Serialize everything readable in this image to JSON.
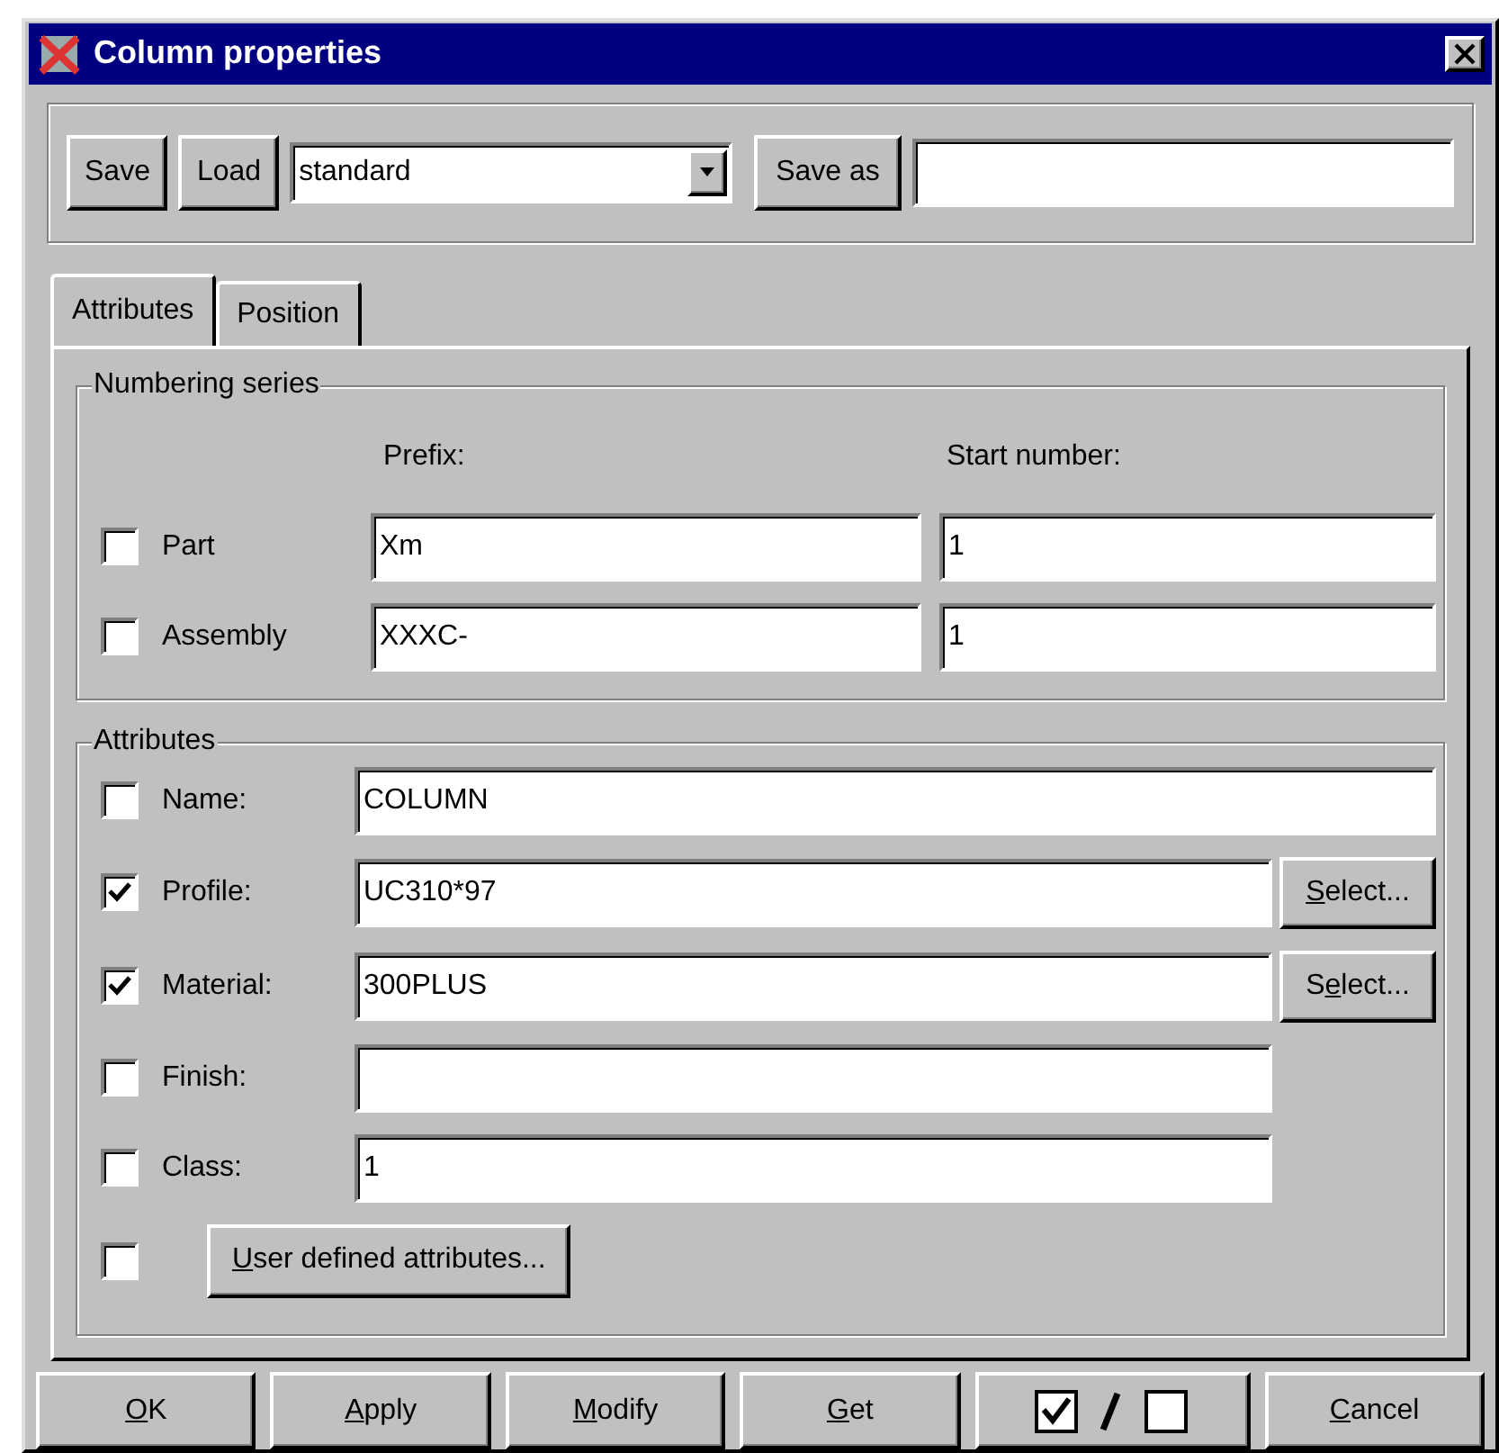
{
  "window": {
    "title": "Column properties"
  },
  "toolbar": {
    "save": "Save",
    "load": "Load",
    "preset": "standard",
    "save_as": "Save as"
  },
  "tabs": [
    {
      "label": "Attributes",
      "selected": true
    },
    {
      "label": "Position",
      "selected": false
    }
  ],
  "numbering": {
    "title": "Numbering series",
    "headers": [
      "Prefix:",
      "Start number:"
    ],
    "rows": [
      {
        "label": "Part",
        "checked": false,
        "prefix": "Xm",
        "start": "1"
      },
      {
        "label": "Assembly",
        "checked": false,
        "prefix": "XXXC-",
        "start": "1"
      }
    ]
  },
  "attributes": {
    "title": "Attributes",
    "rows": [
      {
        "kind": "wide",
        "label": "Name:",
        "checked": false,
        "value": "COLUMN"
      },
      {
        "kind": "select",
        "label": "Profile:",
        "checked": true,
        "value": "UC310*97",
        "button": {
          "key": "S",
          "after": "elect..."
        }
      },
      {
        "kind": "select",
        "label": "Material:",
        "checked": true,
        "value": "300PLUS",
        "button": {
          "before": "S",
          "key": "e",
          "after": "lect..."
        }
      },
      {
        "kind": "field",
        "label": "Finish:",
        "checked": false
      },
      {
        "kind": "field",
        "label": "Class:",
        "checked": false,
        "value": "1"
      },
      {
        "kind": "button",
        "checked": false,
        "button": {
          "key": "U",
          "after": "ser defined attributes..."
        }
      }
    ]
  },
  "buttons": [
    {
      "kind": "text",
      "key": "O",
      "after": "K"
    },
    {
      "kind": "text",
      "key": "A",
      "after": "pply"
    },
    {
      "kind": "text",
      "key": "M",
      "after": "odify"
    },
    {
      "kind": "text",
      "key": "G",
      "after": "et"
    },
    {
      "kind": "toggle"
    },
    {
      "kind": "text",
      "key": "C",
      "after": "ancel"
    }
  ]
}
